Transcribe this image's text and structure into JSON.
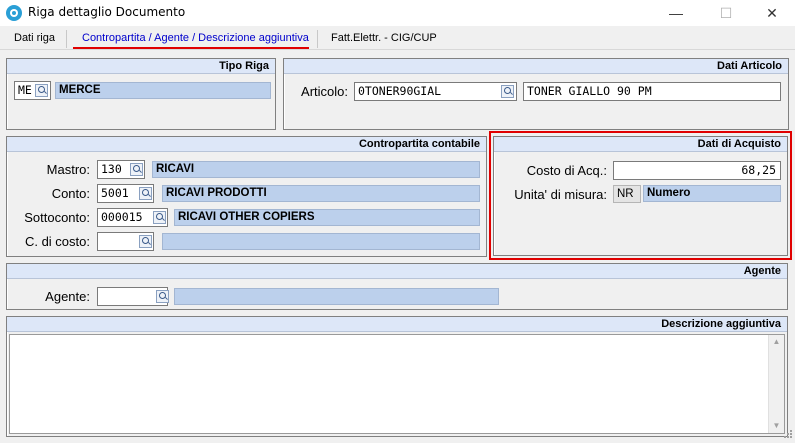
{
  "window": {
    "title": "Riga dettaglio Documento",
    "minimize": "—",
    "maximize": "☐",
    "close": "✕"
  },
  "tabs": [
    {
      "label": "Dati riga"
    },
    {
      "label": "Contropartita / Agente / Descrizione aggiuntiva",
      "active": true
    },
    {
      "label": "Fatt.Elettr. - CIG/CUP"
    }
  ],
  "tipo_riga": {
    "header": "Tipo Riga",
    "code": "ME",
    "description": "MERCE"
  },
  "dati_articolo": {
    "header": "Dati Articolo",
    "articolo_label": "Articolo:",
    "articolo_code": "0TONER90GIAL",
    "articolo_description": "TONER GIALLO 90 PM"
  },
  "contropartita": {
    "header": "Contropartita contabile",
    "mastro": {
      "label": "Mastro:",
      "code": "130",
      "description": "RICAVI"
    },
    "conto": {
      "label": "Conto:",
      "code": "5001",
      "description": "RICAVI PRODOTTI"
    },
    "sottoconto": {
      "label": "Sottoconto:",
      "code": "000015",
      "description": "RICAVI OTHER COPIERS"
    },
    "centro_costo": {
      "label": "C. di costo:",
      "code": "",
      "description": ""
    }
  },
  "dati_acquisto": {
    "header": "Dati di Acquisto",
    "costo_label": "Costo di Acq.:",
    "costo_value": "68,25",
    "um_label": "Unita' di misura:",
    "um_code": "NR",
    "um_description": "Numero"
  },
  "agente": {
    "header": "Agente",
    "label": "Agente:",
    "code": "",
    "description": ""
  },
  "descrizione_aggiuntiva": {
    "header": "Descrizione aggiuntiva",
    "text": ""
  },
  "colors": {
    "panel_header": "#dde7f8",
    "desc_field": "#bcd0ec",
    "highlight": "#e00000",
    "active_tab": "#0000cc"
  }
}
